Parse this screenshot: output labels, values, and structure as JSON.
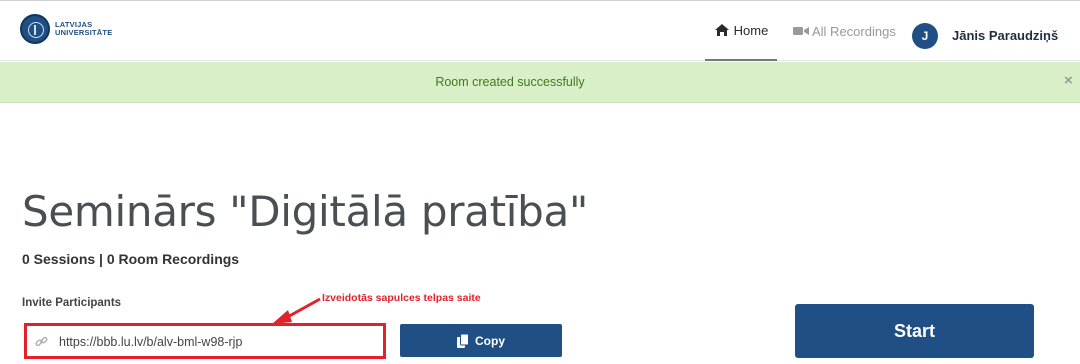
{
  "header": {
    "logo": {
      "line1": "LATVIJAS",
      "line2": "UNIVERSITĀTE"
    },
    "nav": {
      "home": {
        "label": "Home",
        "icon": "home-icon"
      },
      "recordings": {
        "label": "All Recordings",
        "icon": "video-camera-icon"
      }
    },
    "user": {
      "initial": "J",
      "name": "Jānis Paraudziņš"
    }
  },
  "flash": {
    "message": "Room created successfully",
    "close": "×"
  },
  "room": {
    "title": "Seminārs \"Digitālā pratība\"",
    "stats": "0 Sessions | 0 Room Recordings",
    "invite_label": "Invite Participants",
    "invite_url": "https://bbb.lu.lv/b/alv-bml-w98-rjp",
    "copy_label": "Copy",
    "start_label": "Start",
    "annotation": "Izveidotās sapulces telpas saite"
  },
  "colors": {
    "brand": "#1f4f84",
    "flash_bg": "#d9efc8",
    "flash_text": "#3f7a1e",
    "annotation": "#e0232b"
  }
}
